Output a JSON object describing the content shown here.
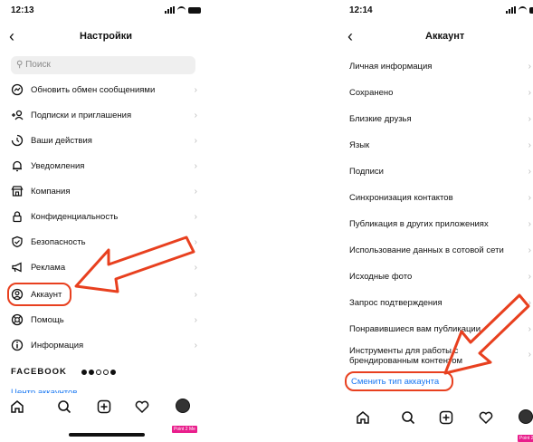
{
  "left": {
    "status": {
      "time": "12:13"
    },
    "header": {
      "title": "Настройки"
    },
    "search": {
      "placeholder": "Поиск"
    },
    "items": [
      {
        "label": "Обновить обмен сообщениями",
        "icon": "messenger-icon"
      },
      {
        "label": "Подписки и приглашения",
        "icon": "add-user-icon"
      },
      {
        "label": "Ваши действия",
        "icon": "activity-icon"
      },
      {
        "label": "Уведомления",
        "icon": "bell-icon"
      },
      {
        "label": "Компания",
        "icon": "shop-icon"
      },
      {
        "label": "Конфиденциальность",
        "icon": "lock-icon"
      },
      {
        "label": "Безопасность",
        "icon": "shield-icon"
      },
      {
        "label": "Реклама",
        "icon": "megaphone-icon"
      },
      {
        "label": "Аккаунт",
        "icon": "account-icon"
      },
      {
        "label": "Помощь",
        "icon": "lifebuoy-icon"
      },
      {
        "label": "Информация",
        "icon": "info-icon"
      }
    ],
    "facebook_label": "FACEBOOK",
    "accounts_center": "Центр аккаунтов",
    "watermark": "Point 2 Me"
  },
  "right": {
    "status": {
      "time": "12:14"
    },
    "header": {
      "title": "Аккаунт"
    },
    "items": [
      {
        "label": "Личная информация"
      },
      {
        "label": "Сохранено"
      },
      {
        "label": "Близкие друзья"
      },
      {
        "label": "Язык"
      },
      {
        "label": "Подписи"
      },
      {
        "label": "Синхронизация контактов"
      },
      {
        "label": "Публикация в других приложениях"
      },
      {
        "label": "Использование данных в сотовой сети"
      },
      {
        "label": "Исходные фото"
      },
      {
        "label": "Запрос подтверждения"
      },
      {
        "label": "Понравившиеся вам публикации"
      }
    ],
    "tools_line1": "Инструменты для работы с",
    "tools_line2": "брендированным контентом",
    "switch_account": "Сменить тип аккаунта",
    "watermark": "Point 2 Me"
  },
  "colors": {
    "annotation": "#e8401f",
    "link": "#1877f2"
  }
}
